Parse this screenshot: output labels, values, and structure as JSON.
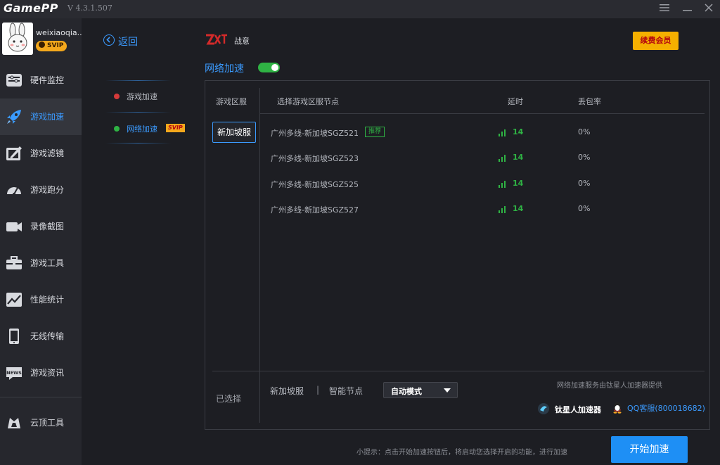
{
  "titlebar": {
    "app_name": "GamePP",
    "version": "V 4.3.1.507",
    "menu_icon": "hamburger-icon",
    "min_icon": "minimize-icon",
    "close_icon": "close-icon"
  },
  "user": {
    "name": "weixiaoqia..",
    "badge": "SVIP"
  },
  "nav": [
    {
      "label": "硬件监控",
      "icon": "hardware-monitor-icon"
    },
    {
      "label": "游戏加速",
      "icon": "rocket-icon",
      "active": true
    },
    {
      "label": "游戏滤镜",
      "icon": "filter-icon"
    },
    {
      "label": "游戏跑分",
      "icon": "speedometer-icon"
    },
    {
      "label": "录像截图",
      "icon": "camera-icon"
    },
    {
      "label": "游戏工具",
      "icon": "toolbox-icon"
    },
    {
      "label": "性能统计",
      "icon": "chart-icon"
    },
    {
      "label": "无线传输",
      "icon": "phone-icon"
    },
    {
      "label": "游戏资讯",
      "icon": "news-icon"
    },
    {
      "label": "云顶工具",
      "icon": "tft-icon"
    }
  ],
  "submenu": {
    "back_label": "返回",
    "items": [
      {
        "label": "游戏加速",
        "dot_color": "#d63a3a"
      },
      {
        "label": "网络加速",
        "dot_color": "#2fb344",
        "badge": "SVIP",
        "active": true
      }
    ]
  },
  "game": {
    "name": "战意",
    "renew_label": "续费会员"
  },
  "network": {
    "title": "网络加速",
    "enabled": true
  },
  "table": {
    "col_region": "游戏区服",
    "col_node": "选择游戏区服节点",
    "col_latency": "延时",
    "col_loss": "丢包率",
    "region": "新加坡服",
    "rows": [
      {
        "node": "广州多线-新加坡SGZ521",
        "tag": "推荐",
        "latency": "14",
        "loss": "0%"
      },
      {
        "node": "广州多线-新加坡SGZ523",
        "tag": "",
        "latency": "14",
        "loss": "0%"
      },
      {
        "node": "广州多线-新加坡SGZ525",
        "tag": "",
        "latency": "14",
        "loss": "0%"
      },
      {
        "node": "广州多线-新加坡SGZ527",
        "tag": "",
        "latency": "14",
        "loss": "0%"
      }
    ]
  },
  "selection": {
    "label": "已选择",
    "region": "新加坡服",
    "separator": "|",
    "node": "智能节点",
    "mode": "自动模式",
    "provider_note": "网络加速服务由钛星人加速器提供",
    "brand": "钛星人加速器",
    "qq": "QQ客服(800018682)"
  },
  "footer": {
    "tip": "小提示：点击开始加速按钮后，将启动您选择开启的功能，进行加速",
    "start_label": "开始加速"
  },
  "colors": {
    "accent": "#3b9bff",
    "green": "#2fb344",
    "gold": "#f5b000",
    "start": "#1e8ff5"
  }
}
